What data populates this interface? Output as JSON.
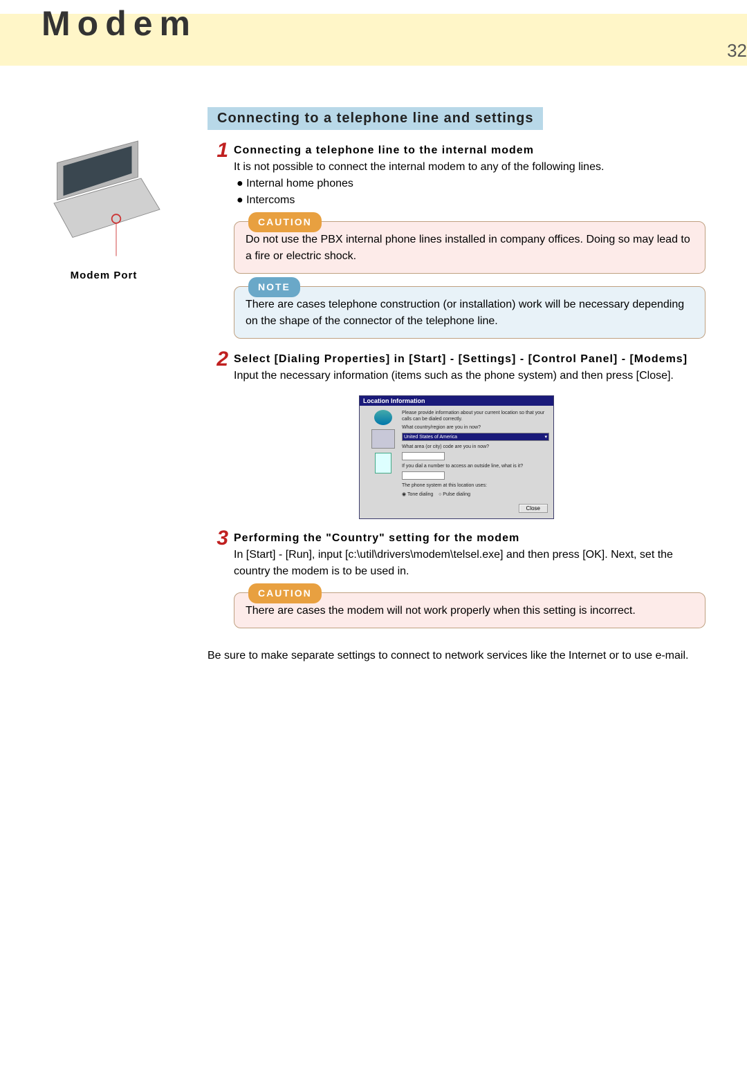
{
  "header": {
    "title": "Modem",
    "page_number": "32"
  },
  "figure": {
    "caption": "Modem Port"
  },
  "section": {
    "title": "Connecting to a telephone line and settings"
  },
  "steps": {
    "s1": {
      "num": "1",
      "title": "Connecting a telephone line to the internal modem",
      "intro": "It is not possible to connect the internal modem to any of the following lines.",
      "bullet1": "● Internal home phones",
      "bullet2": "● Intercoms"
    },
    "s2": {
      "num": "2",
      "title": "Select [Dialing Properties] in [Start] - [Settings] - [Control Panel] - [Modems]",
      "body": "Input the necessary information (items such as the phone system) and then press [Close]."
    },
    "s3": {
      "num": "3",
      "title": "Performing the \"Country\" setting for the modem",
      "body": "In [Start] - [Run], input [c:\\util\\drivers\\modem\\telsel.exe] and then press [OK]. Next, set the country the modem is to be used in."
    }
  },
  "callouts": {
    "caution1": {
      "label": "CAUTION",
      "text": "Do not use the PBX internal phone lines installed in company offices.  Doing so may lead to a fire or electric shock."
    },
    "note1": {
      "label": "NOTE",
      "text": "There are cases telephone construction (or installation) work will be necessary depending on the shape of the connector of the telephone line."
    },
    "caution2": {
      "label": "CAUTION",
      "text": "There are cases the modem will not work properly when this setting is incorrect."
    }
  },
  "dialog": {
    "title": "Location Information",
    "line1": "Please provide information about your current location so that your calls can be dialed correctly.",
    "q1": "What country/region are you in now?",
    "select_value": "United States of America",
    "q2": "What area (or city) code are you in now?",
    "q3": "If you dial a number to access an outside line, what is it?",
    "radio_label": "The phone system at this location uses:",
    "radio1": "Tone dialing",
    "radio2": "Pulse dialing",
    "button": "Close"
  },
  "closing": "Be sure to make separate settings to connect to network services like the Internet or to use e-mail."
}
